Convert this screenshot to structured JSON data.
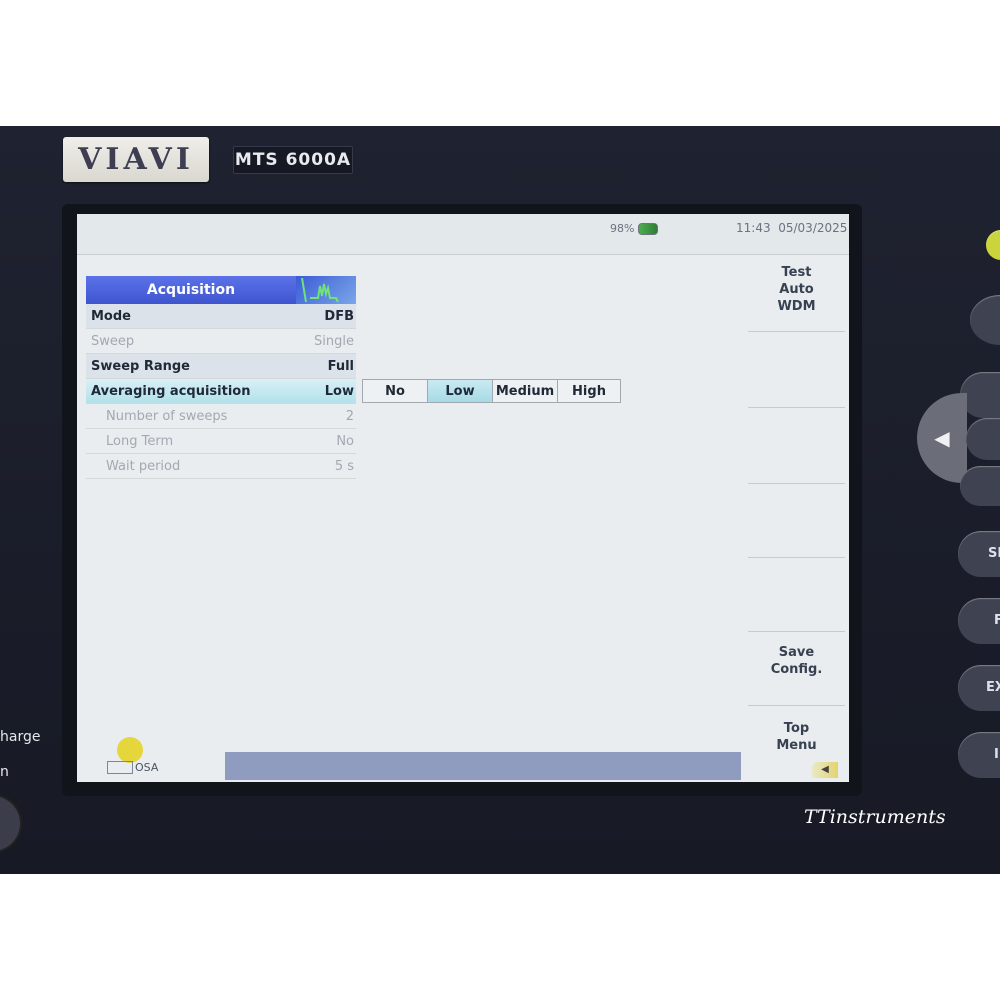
{
  "device": {
    "brand": "VIAVI",
    "model": "MTS 6000A",
    "side_label_1": "harge",
    "side_label_2": "n",
    "hardware_keys": [
      "SE",
      "F",
      "EX",
      "I"
    ],
    "watermark": "TTinstruments"
  },
  "status": {
    "battery": "98%",
    "time": "11:43",
    "date": "05/03/2025"
  },
  "panel": {
    "title": "Acquisition",
    "rows": [
      {
        "label": "Mode",
        "value": "DFB",
        "state": "active"
      },
      {
        "label": "Sweep",
        "value": "Single",
        "state": "disabled"
      },
      {
        "label": "Sweep Range",
        "value": "Full",
        "state": "active"
      },
      {
        "label": "Averaging acquisition",
        "value": "Low",
        "state": "selected"
      },
      {
        "label": "Number of sweeps",
        "value": "2",
        "state": "disabled"
      },
      {
        "label": "Long Term",
        "value": "No",
        "state": "disabled"
      },
      {
        "label": "Wait period",
        "value": "5 s",
        "state": "disabled"
      }
    ]
  },
  "averaging_options": {
    "items": [
      "No",
      "Low",
      "Medium",
      "High"
    ],
    "selected": "Low"
  },
  "softkeys": {
    "key1_line1": "Test",
    "key1_line2": "Auto",
    "key1_line3": "WDM",
    "key7_line1": "Save",
    "key7_line2": "Config.",
    "key8_line1": "Top",
    "key8_line2": "Menu"
  },
  "bottom": {
    "tab_label": "OSA"
  },
  "colors": {
    "header": "#3e55d0",
    "selection": "#b3e1ea",
    "screen_bg": "#e9edef",
    "bottom_strip": "#8f9cbf"
  }
}
